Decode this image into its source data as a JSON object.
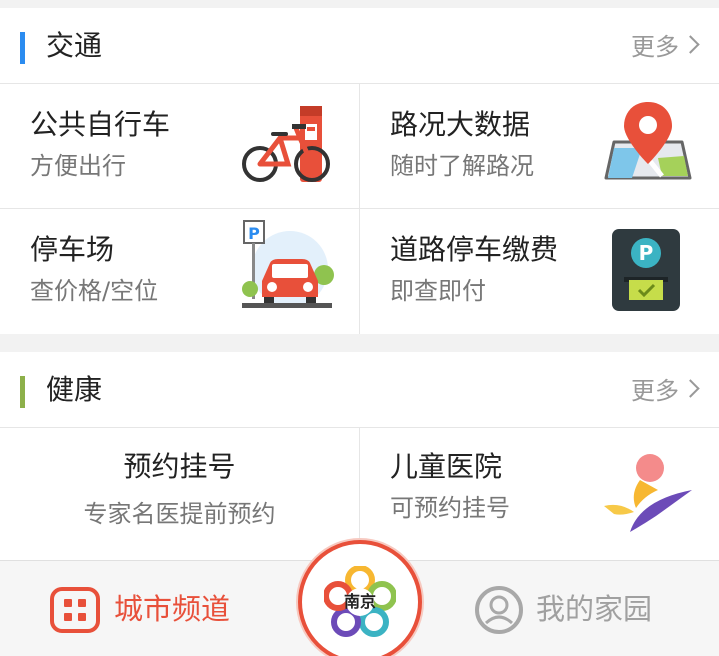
{
  "transport": {
    "title": "交通",
    "more_label": "更多",
    "accent": "#2b8cf0",
    "items": [
      {
        "title": "公共自行车",
        "subtitle": "方便出行",
        "icon": "bicycle-icon"
      },
      {
        "title": "路况大数据",
        "subtitle": "随时了解路况",
        "icon": "map-pin-icon"
      },
      {
        "title": "停车场",
        "subtitle": "查价格/空位",
        "icon": "parking-car-icon"
      },
      {
        "title": "道路停车缴费",
        "subtitle": "即查即付",
        "icon": "parking-meter-icon"
      }
    ]
  },
  "health": {
    "title": "健康",
    "more_label": "更多",
    "accent": "#8db04a",
    "items": [
      {
        "title": "预约挂号",
        "subtitle": "专家名医提前预约",
        "icon": ""
      },
      {
        "title": "儿童医院",
        "subtitle": "可预约挂号",
        "icon": "children-hospital-logo-icon"
      }
    ]
  },
  "tabbar": {
    "city_channel": {
      "label": "城市频道",
      "icon": "grid-icon",
      "color": "#e8503a"
    },
    "center": {
      "label": "南京",
      "icon": "nanjing-logo-icon"
    },
    "my_home": {
      "label": "我的家园",
      "icon": "user-face-icon",
      "color": "#a0a0a0"
    }
  }
}
